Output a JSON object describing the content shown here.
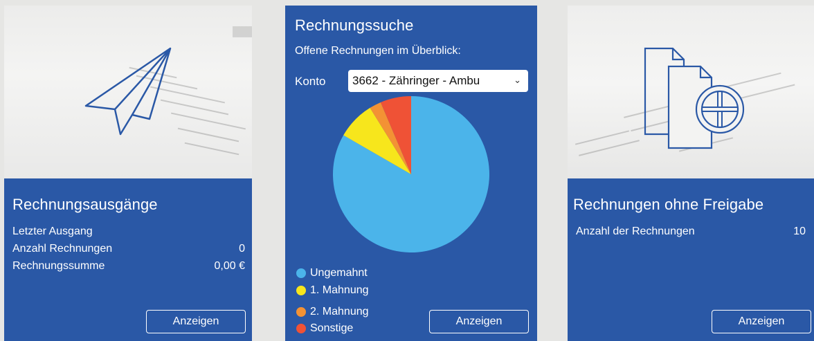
{
  "cards": {
    "outgoing": {
      "title": "Rechnungsausgänge",
      "rows": [
        {
          "label": "Letzter Ausgang",
          "value": ""
        },
        {
          "label": "Anzahl Rechnungen",
          "value": "0"
        },
        {
          "label": "Rechnungssumme",
          "value": "0,00 €"
        }
      ],
      "button": "Anzeigen",
      "icon": "paper-plane-icon"
    },
    "search": {
      "title": "Rechnungssuche",
      "subtitle": "Offene Rechnungen im Überblick:",
      "konto_label": "Konto",
      "konto_value": "3662 - Zähringer - Ambu",
      "button": "Anzeigen"
    },
    "approval": {
      "title": "Rechnungen ohne Freigabe",
      "rows": [
        {
          "label": "Anzahl der Rechnungen",
          "value": "10"
        }
      ],
      "button": "Anzeigen",
      "icon": "documents-stamp-icon"
    }
  },
  "chart_data": {
    "type": "pie",
    "series": [
      {
        "name": "Ungemahnt",
        "value": 0.85,
        "color": "#4bb4ea"
      },
      {
        "name": "1. Mahnung",
        "value": 0.08,
        "color": "#f7e61c"
      },
      {
        "name": "2. Mahnung",
        "value": 0.025,
        "color": "#f39234"
      },
      {
        "name": "Sonstige",
        "value": 0.065,
        "color": "#ef5236"
      }
    ],
    "legend_position": "bottom-left"
  }
}
